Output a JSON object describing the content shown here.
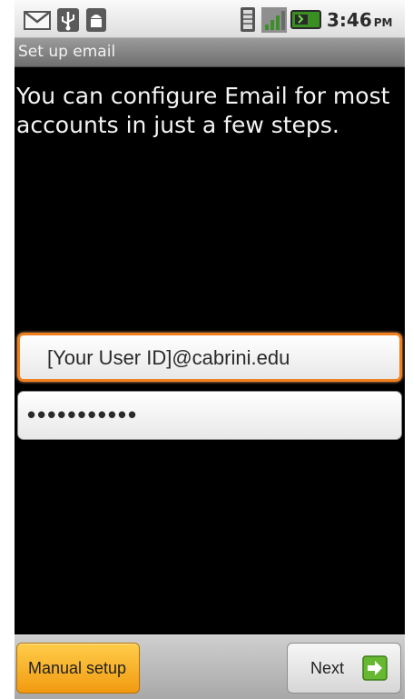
{
  "status_bar": {
    "time": "3:46",
    "ampm": "PM",
    "icons": [
      "gmail-icon",
      "usb-icon",
      "android-debug-icon",
      "vibrate-icon",
      "signal-icon",
      "battery-icon"
    ]
  },
  "title_bar": {
    "title": "Set up email"
  },
  "intro": {
    "text": "You can configure Email for most accounts in just a few steps."
  },
  "form": {
    "email_value": "[Your User ID]@cabrini.edu",
    "password_masked": "•••••••••••"
  },
  "buttons": {
    "manual_setup": "Manual setup",
    "next": "Next"
  },
  "colors": {
    "focus_orange": "#f0801f",
    "manual_button": "#f2a51c",
    "next_arrow_green": "#66b830"
  }
}
